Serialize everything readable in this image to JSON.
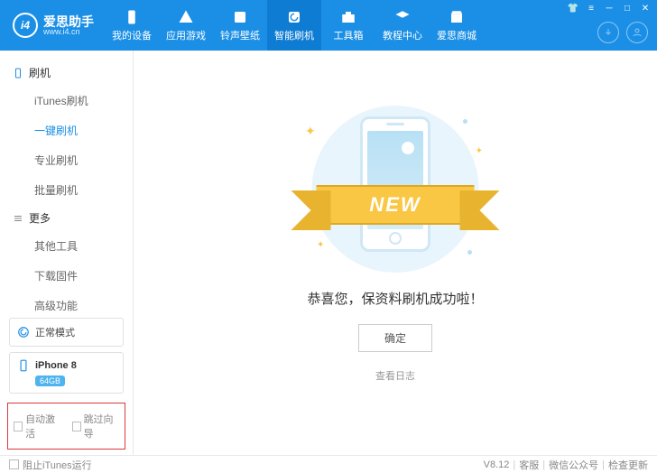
{
  "logo": {
    "icon": "i4",
    "title": "爱思助手",
    "sub": "www.i4.cn"
  },
  "tabs": [
    {
      "id": "device",
      "label": "我的设备"
    },
    {
      "id": "apps",
      "label": "应用游戏"
    },
    {
      "id": "ring",
      "label": "铃声壁纸"
    },
    {
      "id": "flash",
      "label": "智能刷机",
      "active": true
    },
    {
      "id": "tools",
      "label": "工具箱"
    },
    {
      "id": "tutorial",
      "label": "教程中心"
    },
    {
      "id": "mall",
      "label": "爱思商城"
    }
  ],
  "sidebar": {
    "group1": {
      "title": "刷机",
      "items": [
        "iTunes刷机",
        "一键刷机",
        "专业刷机",
        "批量刷机"
      ],
      "activeIndex": 1
    },
    "group2": {
      "title": "更多",
      "items": [
        "其他工具",
        "下载固件",
        "高级功能"
      ]
    },
    "status": {
      "label": "正常模式"
    },
    "device": {
      "name": "iPhone 8",
      "storage": "64GB"
    },
    "checks": {
      "c1": "自动激活",
      "c2": "跳过向导"
    }
  },
  "main": {
    "ribbon": "NEW",
    "message": "恭喜您，保资料刷机成功啦！",
    "ok": "确定",
    "log": "查看日志"
  },
  "footer": {
    "block": "阻止iTunes运行",
    "version": "V8.12",
    "links": [
      "客服",
      "微信公众号",
      "检查更新"
    ]
  }
}
